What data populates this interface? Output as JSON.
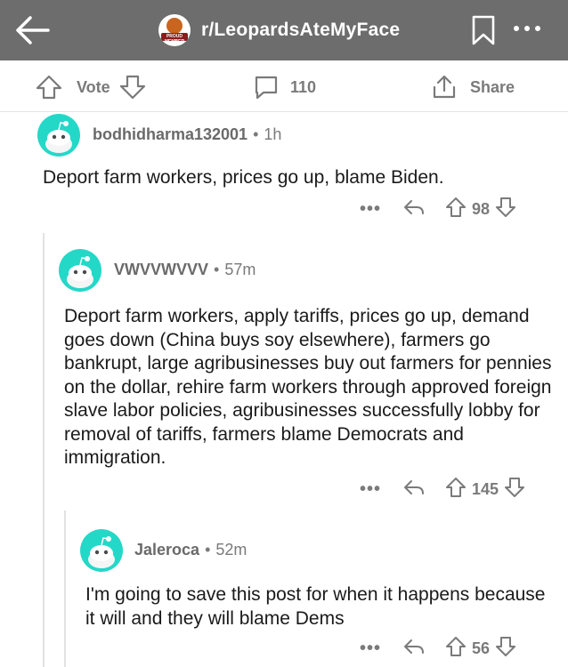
{
  "header": {
    "subreddit": "r/LeopardsAteMyFace",
    "avatar_badge": "PROUD MEMBER",
    "back_icon": "back-arrow-icon",
    "bookmark_icon": "bookmark-icon",
    "more_icon": "more-dots-icon"
  },
  "actions": {
    "vote_label": "Vote",
    "comments_count": "110",
    "share_label": "Share"
  },
  "comments": [
    {
      "user": "bodhidharma132001",
      "age": "1h",
      "text": "Deport farm workers, prices go up, blame Biden.",
      "score": "98"
    },
    {
      "user": "VWVVWVVV",
      "age": "57m",
      "text": "Deport farm workers, apply tariffs, prices go up, demand goes down (China buys soy elsewhere), farmers go bankrupt, large agribusinesses buy out farmers for pennies on the dollar, rehire farm workers through approved foreign slave labor policies, agribusinesses successfully lobby for removal of tariffs, farmers blame Democrats and immigration.",
      "score": "145"
    },
    {
      "user": "Jaleroca",
      "age": "52m",
      "text": "I'm going to save this post for when it happens because it will and they will blame Dems",
      "score": "56"
    }
  ],
  "colors": {
    "header_bg": "#6d6d6e",
    "avatar_bg": "#24d8c8",
    "meta_gray": "#7a7a7b"
  }
}
